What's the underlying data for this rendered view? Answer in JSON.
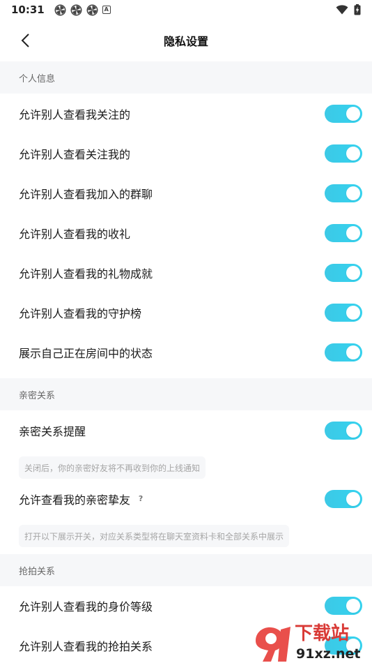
{
  "status_bar": {
    "time": "10:31",
    "a_icon": "A"
  },
  "header": {
    "title": "隐私设置"
  },
  "sections": [
    {
      "title": "个人信息",
      "rows": [
        {
          "label": "允许别人查看我关注的",
          "enabled": true
        },
        {
          "label": "允许别人查看关注我的",
          "enabled": true
        },
        {
          "label": "允许别人查看我加入的群聊",
          "enabled": true
        },
        {
          "label": "允许别人查看我的收礼",
          "enabled": true
        },
        {
          "label": "允许别人查看我的礼物成就",
          "enabled": true
        },
        {
          "label": "允许别人查看我的守护榜",
          "enabled": true
        },
        {
          "label": "展示自己正在房间中的状态",
          "enabled": true
        }
      ]
    },
    {
      "title": "亲密关系",
      "rows": [
        {
          "label": "亲密关系提醒",
          "enabled": true,
          "hint": "关闭后，你的亲密好友将不再收到你的上线通知"
        },
        {
          "label": "允许查看我的亲密挚友",
          "enabled": true,
          "help": "?",
          "hint": "打开以下展示开关，对应关系类型将在聊天室资料卡和全部关系中展示"
        }
      ]
    },
    {
      "title": "抢拍关系",
      "rows": [
        {
          "label": "允许别人查看我的身价等级",
          "enabled": true
        },
        {
          "label": "允许别人查看我的抢拍关系",
          "enabled": true
        }
      ]
    }
  ],
  "colors": {
    "toggle_on": "#3cc9e6",
    "section_bg": "#f6f7f9"
  },
  "watermark": {
    "text": "下载站",
    "domain": "91xz.net"
  }
}
